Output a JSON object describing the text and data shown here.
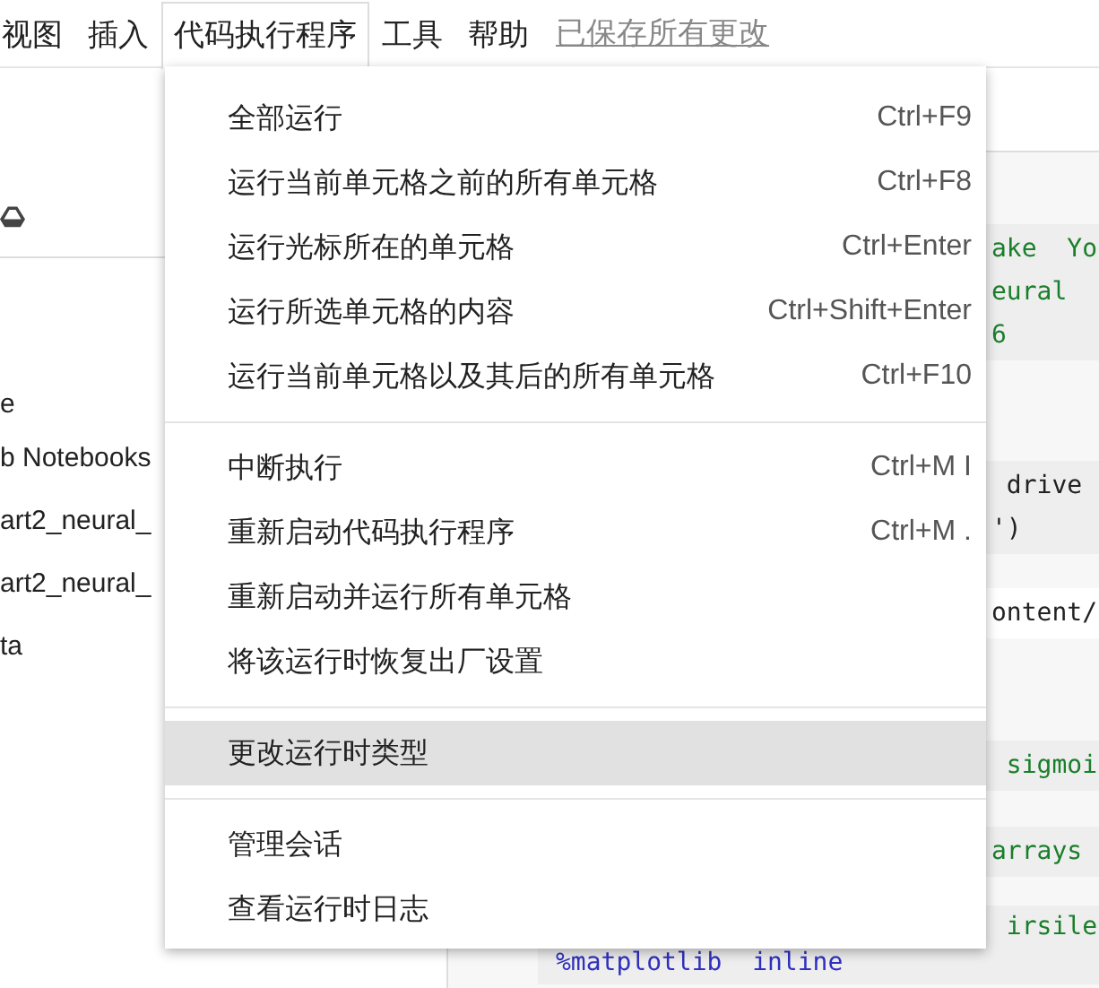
{
  "menubar": [
    {
      "label": "视图",
      "selected": false
    },
    {
      "label": "插入",
      "selected": false
    },
    {
      "label": "代码执行程序",
      "selected": true
    },
    {
      "label": "工具",
      "selected": false
    },
    {
      "label": "帮助",
      "selected": false
    }
  ],
  "save_status": "已保存所有更改",
  "sidebar": {
    "items": [
      {
        "label": "e"
      },
      {
        "label": "b Notebooks"
      },
      {
        "label": "art2_neural_"
      },
      {
        "label": "art2_neural_"
      },
      {
        "label": "ta"
      }
    ]
  },
  "code": [
    {
      "kind": "cell",
      "lines": [
        {
          "kind": "comment",
          "text": "ake  Yo"
        },
        {
          "kind": "comment",
          "text": "eural"
        },
        {
          "kind": "comment",
          "text": "6"
        }
      ]
    },
    {
      "kind": "cell",
      "lines": [
        {
          "kind": "code",
          "text": " drive"
        },
        {
          "kind": "code",
          "text": "')"
        }
      ]
    },
    {
      "kind": "output",
      "lines": [
        {
          "kind": "code",
          "text": "ontent/"
        }
      ]
    },
    {
      "kind": "cell",
      "lines": [
        {
          "kind": "comment",
          "text": " sigmoi"
        }
      ]
    },
    {
      "kind": "cell",
      "lines": [
        {
          "kind": "comment",
          "text": "arrays"
        }
      ]
    },
    {
      "kind": "cell",
      "lines": [
        {
          "kind": "comment",
          "text": " irsile"
        },
        {
          "kind": "magic",
          "text": "%matplotlib  inline"
        }
      ]
    }
  ],
  "menu": [
    {
      "kind": "item",
      "label": "全部运行",
      "shortcut": "Ctrl+F9",
      "selected": false
    },
    {
      "kind": "item",
      "label": "运行当前单元格之前的所有单元格",
      "shortcut": "Ctrl+F8",
      "selected": false
    },
    {
      "kind": "item",
      "label": "运行光标所在的单元格",
      "shortcut": "Ctrl+Enter",
      "selected": false
    },
    {
      "kind": "item",
      "label": "运行所选单元格的内容",
      "shortcut": "Ctrl+Shift+Enter",
      "selected": false
    },
    {
      "kind": "item",
      "label": "运行当前单元格以及其后的所有单元格",
      "shortcut": "Ctrl+F10",
      "selected": false
    },
    {
      "kind": "divider"
    },
    {
      "kind": "item",
      "label": "中断执行",
      "shortcut": "Ctrl+M I",
      "selected": false
    },
    {
      "kind": "item",
      "label": "重新启动代码执行程序",
      "shortcut": "Ctrl+M .",
      "selected": false
    },
    {
      "kind": "item",
      "label": "重新启动并运行所有单元格",
      "selected": false
    },
    {
      "kind": "item",
      "label": "将该运行时恢复出厂设置",
      "selected": false
    },
    {
      "kind": "divider"
    },
    {
      "kind": "item",
      "label": "更改运行时类型",
      "selected": true
    },
    {
      "kind": "divider"
    },
    {
      "kind": "item",
      "label": "管理会话",
      "selected": false
    },
    {
      "kind": "item",
      "label": "查看运行时日志",
      "selected": false
    }
  ]
}
